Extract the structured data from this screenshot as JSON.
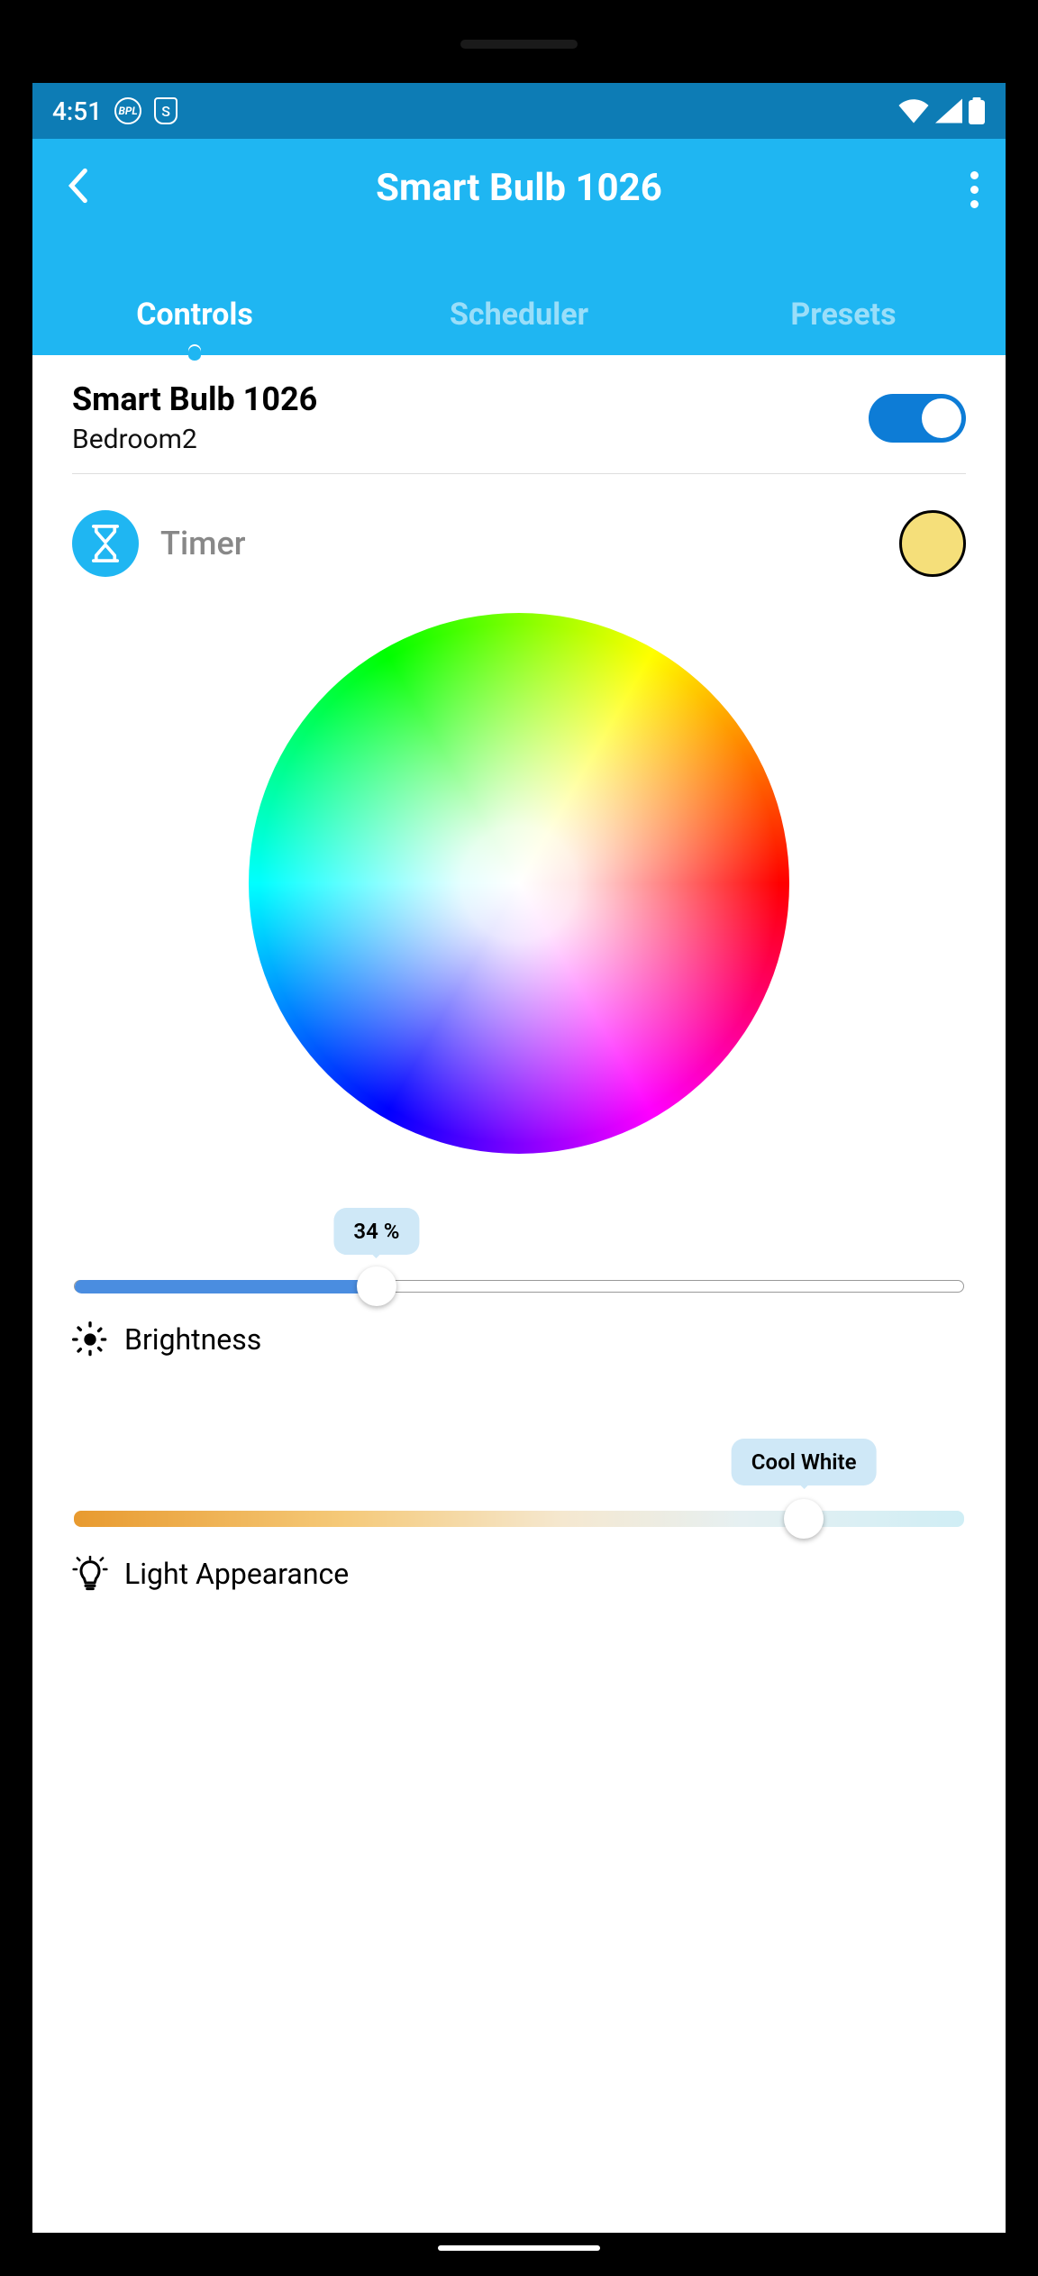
{
  "status_bar": {
    "time": "4:51",
    "badge1": "BPL",
    "badge2": "S"
  },
  "header": {
    "title": "Smart Bulb 1026"
  },
  "tabs": [
    {
      "label": "Controls",
      "active": true
    },
    {
      "label": "Scheduler",
      "active": false
    },
    {
      "label": "Presets",
      "active": false
    }
  ],
  "device": {
    "name": "Smart Bulb 1026",
    "room": "Bedroom2",
    "power_on": true
  },
  "timer": {
    "label": "Timer"
  },
  "current_color": "#f5df7a",
  "brightness": {
    "value_label": "34 %",
    "percent": 34,
    "label": "Brightness"
  },
  "appearance": {
    "value_label": "Cool White",
    "percent": 82,
    "label": "Light Appearance"
  }
}
